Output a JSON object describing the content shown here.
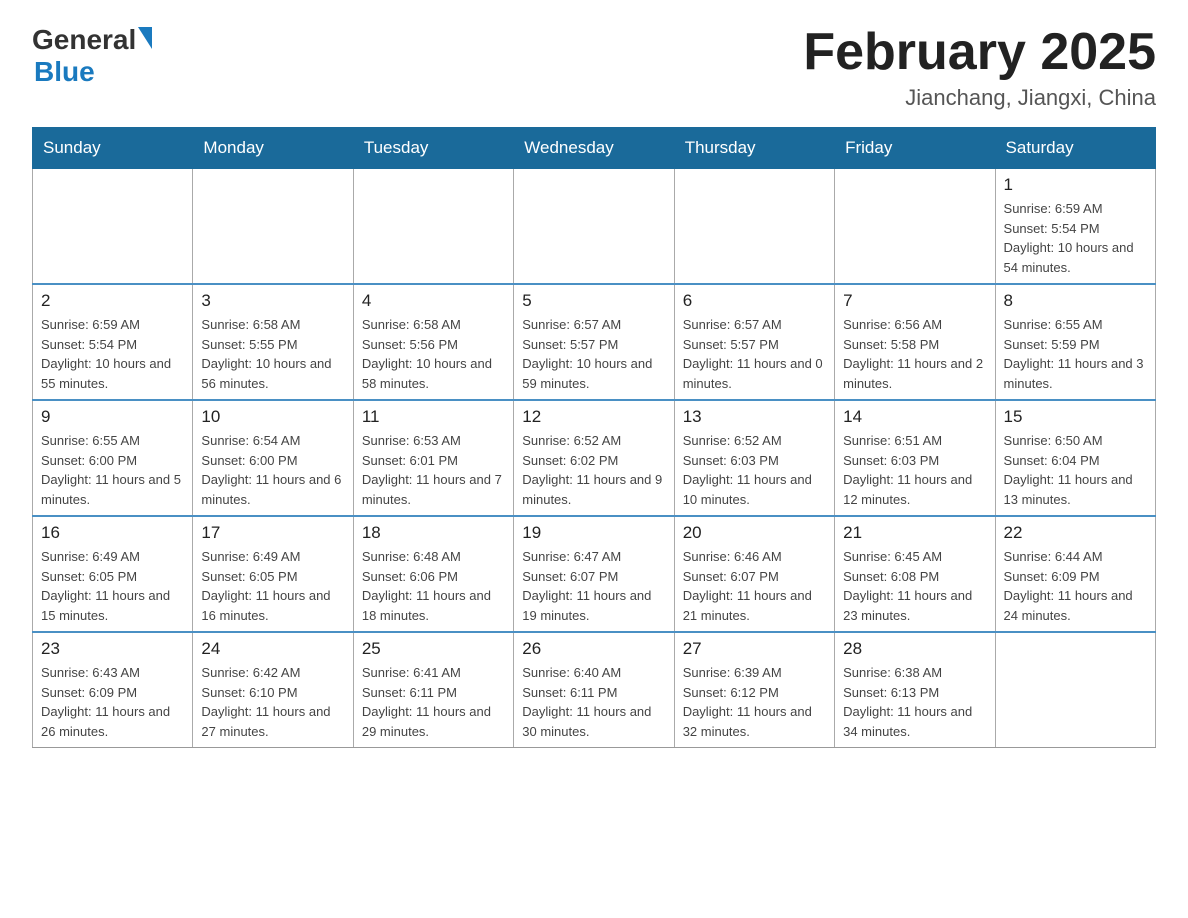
{
  "header": {
    "logo_general": "General",
    "logo_blue": "Blue",
    "title": "February 2025",
    "subtitle": "Jianchang, Jiangxi, China"
  },
  "days_of_week": [
    "Sunday",
    "Monday",
    "Tuesday",
    "Wednesday",
    "Thursday",
    "Friday",
    "Saturday"
  ],
  "weeks": [
    [
      {
        "day": "",
        "info": ""
      },
      {
        "day": "",
        "info": ""
      },
      {
        "day": "",
        "info": ""
      },
      {
        "day": "",
        "info": ""
      },
      {
        "day": "",
        "info": ""
      },
      {
        "day": "",
        "info": ""
      },
      {
        "day": "1",
        "info": "Sunrise: 6:59 AM\nSunset: 5:54 PM\nDaylight: 10 hours and 54 minutes."
      }
    ],
    [
      {
        "day": "2",
        "info": "Sunrise: 6:59 AM\nSunset: 5:54 PM\nDaylight: 10 hours and 55 minutes."
      },
      {
        "day": "3",
        "info": "Sunrise: 6:58 AM\nSunset: 5:55 PM\nDaylight: 10 hours and 56 minutes."
      },
      {
        "day": "4",
        "info": "Sunrise: 6:58 AM\nSunset: 5:56 PM\nDaylight: 10 hours and 58 minutes."
      },
      {
        "day": "5",
        "info": "Sunrise: 6:57 AM\nSunset: 5:57 PM\nDaylight: 10 hours and 59 minutes."
      },
      {
        "day": "6",
        "info": "Sunrise: 6:57 AM\nSunset: 5:57 PM\nDaylight: 11 hours and 0 minutes."
      },
      {
        "day": "7",
        "info": "Sunrise: 6:56 AM\nSunset: 5:58 PM\nDaylight: 11 hours and 2 minutes."
      },
      {
        "day": "8",
        "info": "Sunrise: 6:55 AM\nSunset: 5:59 PM\nDaylight: 11 hours and 3 minutes."
      }
    ],
    [
      {
        "day": "9",
        "info": "Sunrise: 6:55 AM\nSunset: 6:00 PM\nDaylight: 11 hours and 5 minutes."
      },
      {
        "day": "10",
        "info": "Sunrise: 6:54 AM\nSunset: 6:00 PM\nDaylight: 11 hours and 6 minutes."
      },
      {
        "day": "11",
        "info": "Sunrise: 6:53 AM\nSunset: 6:01 PM\nDaylight: 11 hours and 7 minutes."
      },
      {
        "day": "12",
        "info": "Sunrise: 6:52 AM\nSunset: 6:02 PM\nDaylight: 11 hours and 9 minutes."
      },
      {
        "day": "13",
        "info": "Sunrise: 6:52 AM\nSunset: 6:03 PM\nDaylight: 11 hours and 10 minutes."
      },
      {
        "day": "14",
        "info": "Sunrise: 6:51 AM\nSunset: 6:03 PM\nDaylight: 11 hours and 12 minutes."
      },
      {
        "day": "15",
        "info": "Sunrise: 6:50 AM\nSunset: 6:04 PM\nDaylight: 11 hours and 13 minutes."
      }
    ],
    [
      {
        "day": "16",
        "info": "Sunrise: 6:49 AM\nSunset: 6:05 PM\nDaylight: 11 hours and 15 minutes."
      },
      {
        "day": "17",
        "info": "Sunrise: 6:49 AM\nSunset: 6:05 PM\nDaylight: 11 hours and 16 minutes."
      },
      {
        "day": "18",
        "info": "Sunrise: 6:48 AM\nSunset: 6:06 PM\nDaylight: 11 hours and 18 minutes."
      },
      {
        "day": "19",
        "info": "Sunrise: 6:47 AM\nSunset: 6:07 PM\nDaylight: 11 hours and 19 minutes."
      },
      {
        "day": "20",
        "info": "Sunrise: 6:46 AM\nSunset: 6:07 PM\nDaylight: 11 hours and 21 minutes."
      },
      {
        "day": "21",
        "info": "Sunrise: 6:45 AM\nSunset: 6:08 PM\nDaylight: 11 hours and 23 minutes."
      },
      {
        "day": "22",
        "info": "Sunrise: 6:44 AM\nSunset: 6:09 PM\nDaylight: 11 hours and 24 minutes."
      }
    ],
    [
      {
        "day": "23",
        "info": "Sunrise: 6:43 AM\nSunset: 6:09 PM\nDaylight: 11 hours and 26 minutes."
      },
      {
        "day": "24",
        "info": "Sunrise: 6:42 AM\nSunset: 6:10 PM\nDaylight: 11 hours and 27 minutes."
      },
      {
        "day": "25",
        "info": "Sunrise: 6:41 AM\nSunset: 6:11 PM\nDaylight: 11 hours and 29 minutes."
      },
      {
        "day": "26",
        "info": "Sunrise: 6:40 AM\nSunset: 6:11 PM\nDaylight: 11 hours and 30 minutes."
      },
      {
        "day": "27",
        "info": "Sunrise: 6:39 AM\nSunset: 6:12 PM\nDaylight: 11 hours and 32 minutes."
      },
      {
        "day": "28",
        "info": "Sunrise: 6:38 AM\nSunset: 6:13 PM\nDaylight: 11 hours and 34 minutes."
      },
      {
        "day": "",
        "info": ""
      }
    ]
  ]
}
